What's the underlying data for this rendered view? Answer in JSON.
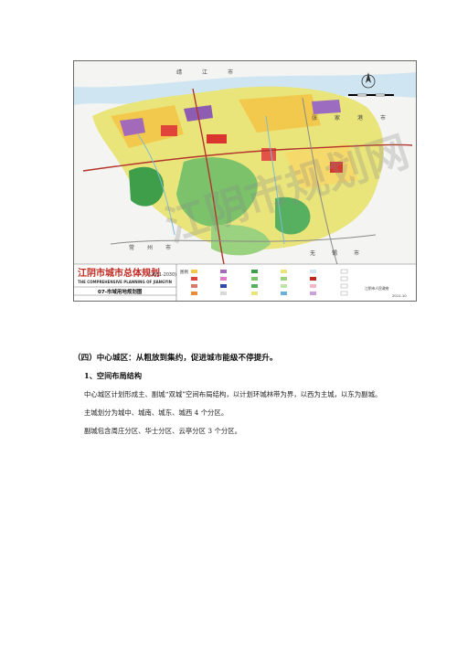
{
  "map": {
    "title": "江阴市城市总体规划",
    "title_years": "(2011-2030)",
    "subtitle": "THE COMPREHENSIVE PLANNING OF JIANGYIN",
    "sheet_name": "07-市域用地规划图",
    "watermark": "江阴市规划网",
    "place_labels": [
      "靖",
      "江",
      "市",
      "张",
      "家",
      "港",
      "市",
      "无",
      "锡",
      "市",
      "常",
      "州",
      "市"
    ],
    "org": "江阴市人民政府",
    "date": "2011.10",
    "legend_label": "图例"
  },
  "section": {
    "heading": "（四）中心城区：从粗放到集约，促进城市能级不停提升。",
    "subheading": "1、空间布局结构",
    "paragraphs": [
      "中心城区计划形成主、副城“双城”空间布局结构，以计划环城林带为界，以西为主城，以东为副城。",
      "主城划分为城中、城南、城东、城西 4 个分区。",
      "副城包含周庄分区、华士分区、云亭分区 3 个分区。"
    ]
  }
}
